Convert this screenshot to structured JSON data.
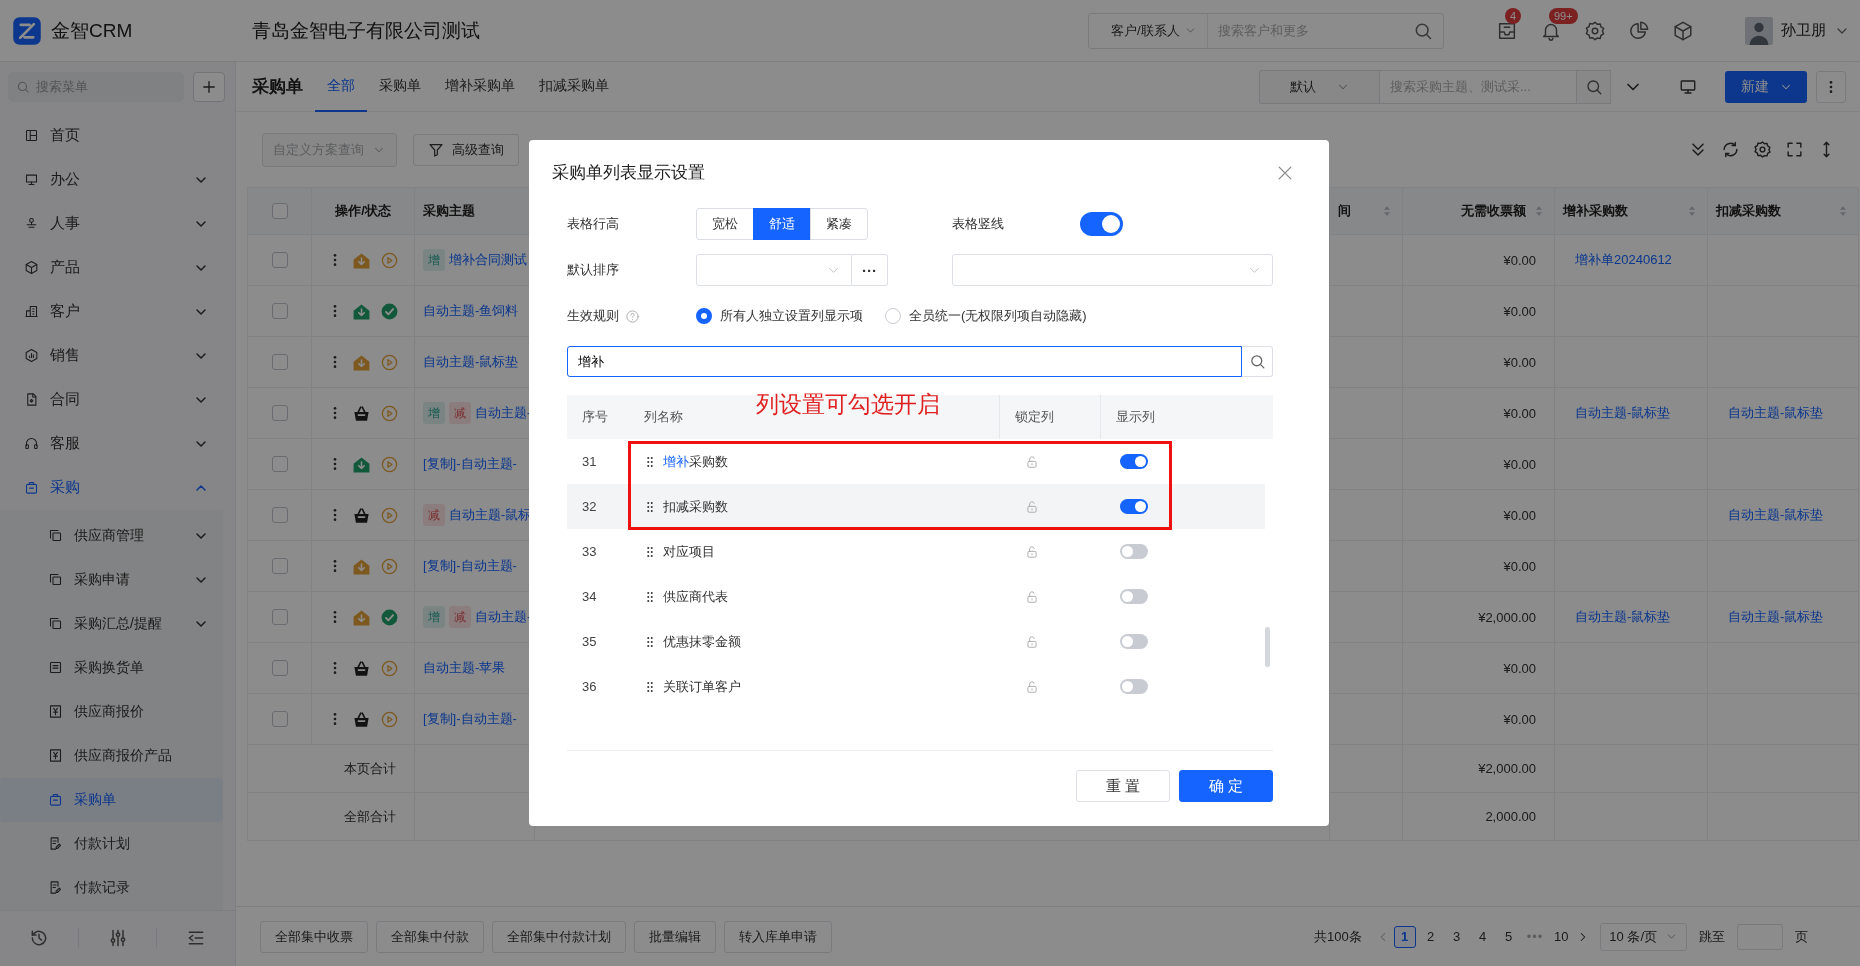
{
  "topbar": {
    "logo_text": "金智CRM",
    "company": "青岛金智电子有限公司测试",
    "search_scope": "客户/联系人",
    "search_placeholder": "搜索客户和更多",
    "mail_badge": "4",
    "bell_badge": "99+",
    "user_name": "孙卫朋"
  },
  "sidebar": {
    "search_placeholder": "搜索菜单",
    "items": [
      {
        "label": "首页",
        "expandable": false,
        "selected": false
      },
      {
        "label": "办公",
        "expandable": true,
        "expanded": false,
        "selected": false
      },
      {
        "label": "人事",
        "expandable": true,
        "expanded": false,
        "selected": false
      },
      {
        "label": "产品",
        "expandable": true,
        "expanded": false,
        "selected": false
      },
      {
        "label": "客户",
        "expandable": true,
        "expanded": false,
        "selected": false
      },
      {
        "label": "销售",
        "expandable": true,
        "expanded": false,
        "selected": false
      },
      {
        "label": "合同",
        "expandable": true,
        "expanded": false,
        "selected": false
      },
      {
        "label": "客服",
        "expandable": true,
        "expanded": false,
        "selected": false
      },
      {
        "label": "采购",
        "expandable": true,
        "expanded": true,
        "selected": true,
        "children": [
          {
            "label": "供应商管理",
            "expandable": true,
            "expanded": false,
            "selected": false
          },
          {
            "label": "采购申请",
            "expandable": true,
            "expanded": false,
            "selected": false
          },
          {
            "label": "采购汇总/提醒",
            "expandable": true,
            "expanded": false,
            "selected": false
          },
          {
            "label": "采购换货单",
            "expandable": false,
            "selected": false
          },
          {
            "label": "供应商报价",
            "expandable": false,
            "selected": false
          },
          {
            "label": "供应商报价产品",
            "expandable": false,
            "selected": false
          },
          {
            "label": "采购单",
            "expandable": false,
            "selected": true
          },
          {
            "label": "付款计划",
            "expandable": false,
            "selected": false
          },
          {
            "label": "付款记录",
            "expandable": false,
            "selected": false
          }
        ]
      }
    ]
  },
  "main": {
    "page_title": "采购单",
    "tabs": [
      {
        "label": "全部",
        "selected": true
      },
      {
        "label": "采购单",
        "selected": false
      },
      {
        "label": "增补采购单",
        "selected": false
      },
      {
        "label": "扣减采购单",
        "selected": false
      }
    ],
    "view_select": "默认",
    "search_placeholder": "搜索采购主题、测试采...",
    "new_button": "新建",
    "scheme_select": "自定义方案查询",
    "advanced_button": "高级查询",
    "table": {
      "header_checked": false,
      "columns": [
        {
          "label": "操作/状态",
          "sortable": false
        },
        {
          "label": "采购主题",
          "sortable": false
        },
        {
          "label": "间",
          "sortable": true
        },
        {
          "label": "无需收票额",
          "sortable": true
        },
        {
          "label": "增补采购数",
          "sortable": true
        },
        {
          "label": "扣减采购数",
          "sortable": true
        }
      ],
      "rows": [
        {
          "checked": false,
          "warehouse": {
            "kind": "pending"
          },
          "status": {
            "kind": "pending"
          },
          "tags": [
            {
              "kind": "add",
              "text": "增"
            }
          ],
          "subject": "增补合同测试",
          "amount": "¥0.00",
          "add_order": "增补单20240612"
        },
        {
          "checked": false,
          "warehouse": {
            "kind": "complete"
          },
          "status": {
            "kind": "approved"
          },
          "subject": "自动主题-鱼饲料",
          "amount": "¥0.00"
        },
        {
          "checked": false,
          "warehouse": {
            "kind": "pending"
          },
          "status": {
            "kind": "pending"
          },
          "subject": "自动主题-鼠标垫",
          "amount": "¥0.00"
        },
        {
          "checked": false,
          "warehouse": {
            "kind": "basket"
          },
          "status": {
            "kind": "pending"
          },
          "tags": [
            {
              "kind": "add",
              "text": "增"
            },
            {
              "kind": "reduce",
              "text": "减"
            }
          ],
          "subject": "自动主题-",
          "amount": "¥0.00",
          "add_order": "自动主题-鼠标垫",
          "reduce_order": "自动主题-鼠标垫"
        },
        {
          "checked": false,
          "warehouse": {
            "kind": "complete"
          },
          "status": {
            "kind": "pending"
          },
          "subject": "[复制]-自动主题-",
          "amount": "¥0.00"
        },
        {
          "checked": false,
          "warehouse": {
            "kind": "basket"
          },
          "status": {
            "kind": "pending"
          },
          "tags": [
            {
              "kind": "reduce",
              "text": "减"
            }
          ],
          "subject": "自动主题-鼠标",
          "amount": "¥0.00",
          "reduce_order": "自动主题-鼠标垫"
        },
        {
          "checked": false,
          "warehouse": {
            "kind": "pending"
          },
          "status": {
            "kind": "pending"
          },
          "subject": "[复制]-自动主题-",
          "amount": "¥0.00"
        },
        {
          "checked": false,
          "warehouse": {
            "kind": "pending"
          },
          "status": {
            "kind": "approved"
          },
          "tags": [
            {
              "kind": "add",
              "text": "增"
            },
            {
              "kind": "reduce",
              "text": "减"
            }
          ],
          "subject": "自动主题-",
          "amount": "¥2,000.00",
          "add_order": "自动主题-鼠标垫",
          "reduce_order": "自动主题-鼠标垫"
        },
        {
          "checked": false,
          "warehouse": {
            "kind": "basket"
          },
          "status": {
            "kind": "pending"
          },
          "subject": "自动主题-苹果",
          "amount": "¥0.00"
        },
        {
          "checked": false,
          "warehouse": {
            "kind": "basket"
          },
          "status": {
            "kind": "pending"
          },
          "subject": "[复制]-自动主题-",
          "amount": "¥0.00"
        }
      ],
      "summary": [
        {
          "label": "本页合计",
          "amount": "¥2,000.00"
        },
        {
          "label": "全部合计",
          "amount": "2,000.00"
        }
      ]
    },
    "bottom_buttons": [
      "全部集中收票",
      "全部集中付款",
      "全部集中付款计划",
      "批量编辑",
      "转入库单申请"
    ],
    "pagination": {
      "total": "共100条",
      "pages": [
        {
          "label": "1",
          "kind": "page",
          "selected": true
        },
        {
          "label": "2",
          "kind": "page",
          "selected": false
        },
        {
          "label": "3",
          "kind": "page",
          "selected": false
        },
        {
          "label": "4",
          "kind": "page",
          "selected": false
        },
        {
          "label": "5",
          "kind": "page",
          "selected": false
        },
        {
          "label": "•••",
          "kind": "more"
        },
        {
          "label": "10",
          "kind": "page",
          "selected": false
        }
      ],
      "page_size": "10 条/页",
      "jump_label": "跳至",
      "page_unit": "页"
    }
  },
  "modal": {
    "title": "采购单列表显示设置",
    "row_height": {
      "label": "表格行高",
      "options": [
        {
          "label": "宽松",
          "selected": false
        },
        {
          "label": "舒适",
          "selected": true
        },
        {
          "label": "紧凑",
          "selected": false
        }
      ]
    },
    "vertical_lines": {
      "label": "表格竖线",
      "on": true
    },
    "default_sort": {
      "label": "默认排序",
      "more": "···"
    },
    "effect_rule": {
      "label": "生效规则",
      "options": [
        {
          "label": "所有人独立设置列显示项",
          "selected": true
        },
        {
          "label": "全员统一(无权限列项自动隐藏)",
          "selected": false
        }
      ]
    },
    "search_value": "增补",
    "annotation": "列设置可勾选开启",
    "columns_list": {
      "headers": [
        "序号",
        "列名称",
        "锁定列",
        "显示列"
      ],
      "rows": [
        {
          "index": "31",
          "name": [
            {
              "text": "增补",
              "match": true
            },
            {
              "text": "采购数",
              "match": false
            }
          ],
          "locked": false,
          "shown": true,
          "hovered": false,
          "boxed": true
        },
        {
          "index": "32",
          "name": [
            {
              "text": "扣减采购数",
              "match": false
            }
          ],
          "locked": false,
          "shown": true,
          "hovered": true,
          "boxed": true
        },
        {
          "index": "33",
          "name": [
            {
              "text": "对应项目",
              "match": false
            }
          ],
          "locked": false,
          "shown": false,
          "hovered": false,
          "boxed": false
        },
        {
          "index": "34",
          "name": [
            {
              "text": "供应商代表",
              "match": false
            }
          ],
          "locked": false,
          "shown": false,
          "hovered": false,
          "boxed": false
        },
        {
          "index": "35",
          "name": [
            {
              "text": "优惠抹零金额",
              "match": false
            }
          ],
          "locked": false,
          "shown": false,
          "hovered": false,
          "boxed": false
        },
        {
          "index": "36",
          "name": [
            {
              "text": "关联订单客户",
              "match": false
            }
          ],
          "locked": false,
          "shown": false,
          "hovered": false,
          "boxed": false
        }
      ]
    },
    "buttons": [
      {
        "label": "重 置",
        "kind": "default"
      },
      {
        "label": "确 定",
        "kind": "primary"
      }
    ]
  }
}
